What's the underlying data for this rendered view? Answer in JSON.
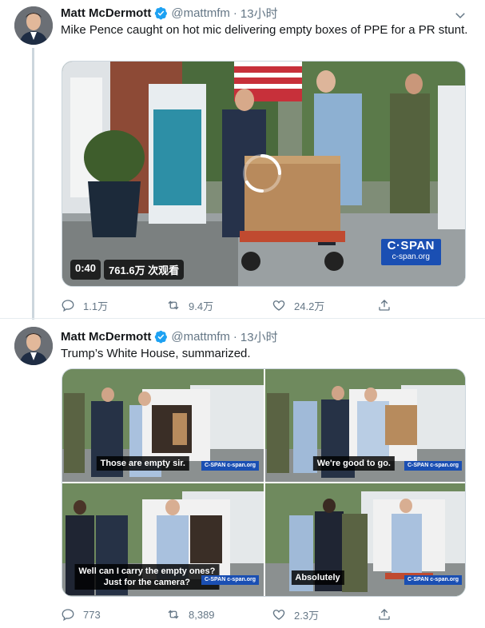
{
  "colors": {
    "accent": "#1da1f2",
    "muted": "#657786",
    "cspan": "#1a4fb3"
  },
  "tweet1": {
    "name": "Matt McDermott",
    "handle": "@mattmfm",
    "dot": "·",
    "time": "13小时",
    "text": "Mike Pence caught on hot mic delivering empty boxes of PPE for a PR stunt.",
    "video": {
      "duration": "0:40",
      "views": "761.6万 次观看",
      "cspan_title": "C·SPAN",
      "cspan_url": "c-span.org"
    },
    "actions": {
      "replies": "1.1万",
      "retweets": "9.4万",
      "likes": "24.2万"
    }
  },
  "tweet2": {
    "name": "Matt McDermott",
    "handle": "@mattmfm",
    "dot": "·",
    "time": "13小时",
    "text": "Trump’s White House, summarized.",
    "images": [
      {
        "subtitle_lines": [
          "Those are empty sir."
        ]
      },
      {
        "subtitle_lines": [
          "We're good to go."
        ]
      },
      {
        "subtitle_lines": [
          "Well can I carry the empty ones?",
          "Just for the camera?"
        ]
      },
      {
        "subtitle_lines": [
          "Absolutely"
        ]
      }
    ],
    "cspan_mini": "C-SPAN c-span.org",
    "actions": {
      "replies": "773",
      "retweets": "8,389",
      "likes": "2.3万"
    }
  },
  "icons": [
    "verified-icon",
    "chevron-down-icon",
    "reply-icon",
    "retweet-icon",
    "like-icon",
    "share-icon",
    "loading-spinner-icon"
  ]
}
